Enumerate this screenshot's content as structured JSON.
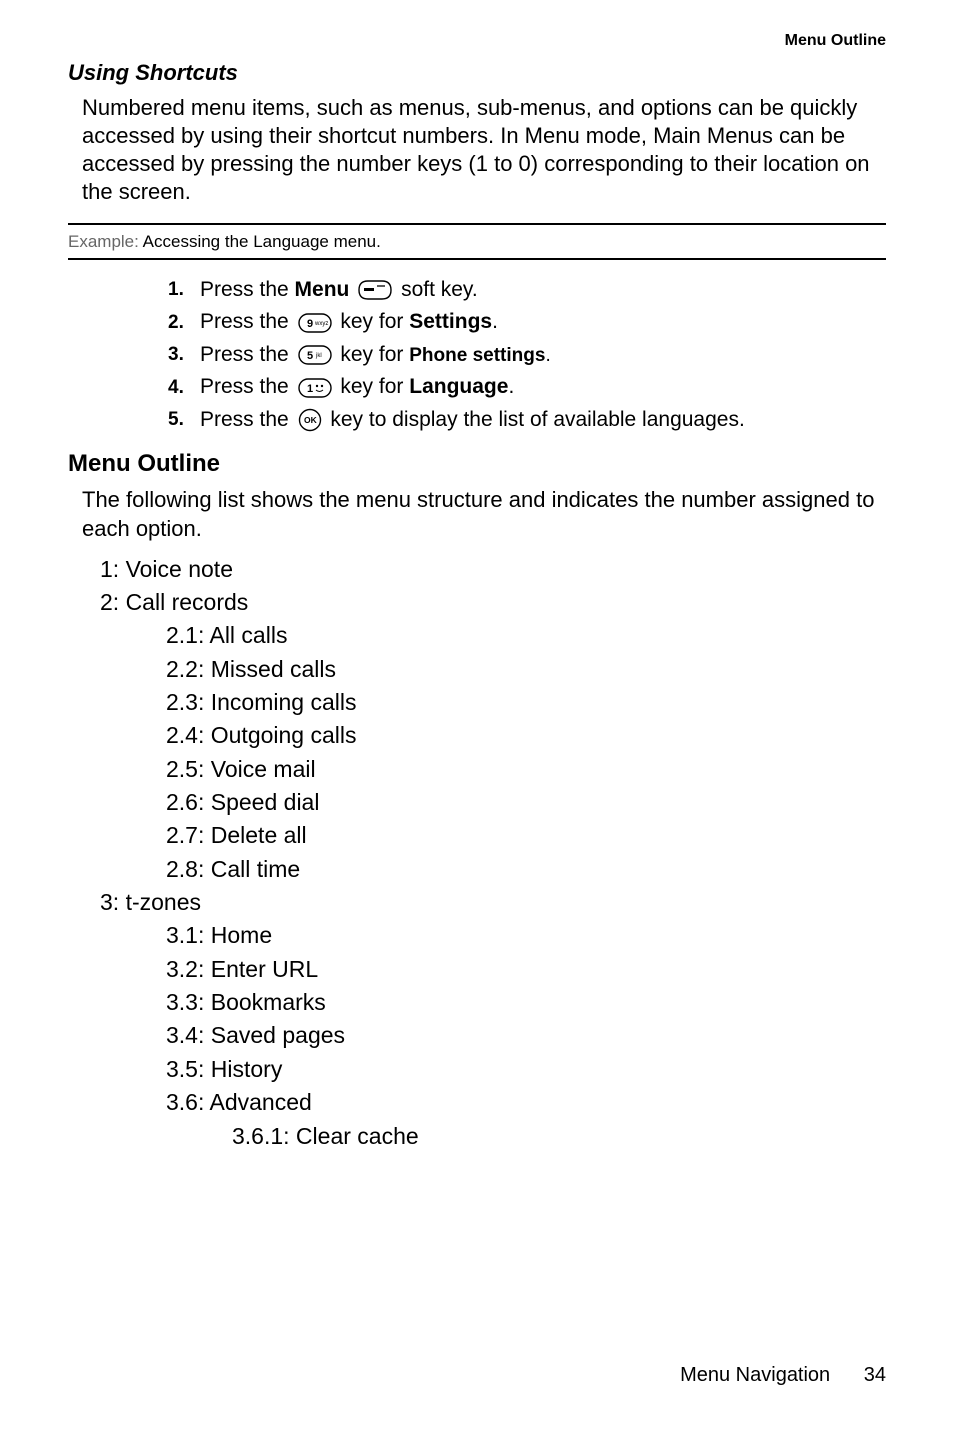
{
  "header": {
    "text": "Menu Outline"
  },
  "section1": {
    "title": "Using Shortcuts",
    "body": "Numbered menu items, such as menus, sub-menus, and options can be quickly accessed by using their shortcut numbers. In Menu mode, Main Menus can be accessed by pressing the number keys (1 to 0) corresponding to their location on the screen."
  },
  "example": {
    "label": "Example: ",
    "text": "Accessing the Language menu."
  },
  "steps": [
    {
      "num": "1.",
      "pre": "Press the ",
      "bold": "Menu",
      "icon": "softkey-left-icon",
      "post": " soft key."
    },
    {
      "num": "2.",
      "pre": "Press the ",
      "icon": "key-9-icon",
      "mid": " key for ",
      "bold": "Settings",
      "post": "."
    },
    {
      "num": "3.",
      "pre": "Press the ",
      "icon": "key-5-icon",
      "mid": " key for ",
      "bold": "Phone settings",
      "post": "."
    },
    {
      "num": "4.",
      "pre": "Press the ",
      "icon": "key-1-icon",
      "mid": " key for ",
      "bold": "Language",
      "post": "."
    },
    {
      "num": "5.",
      "pre": "Press the ",
      "icon": "ok-key-icon",
      "post": " key to display the list of available languages."
    }
  ],
  "section2": {
    "title": "Menu Outline",
    "body": "The following list shows the menu structure and indicates the number assigned to each option."
  },
  "menus": [
    {
      "level": 1,
      "text": "1: Voice note"
    },
    {
      "level": 1,
      "text": "2: Call records"
    },
    {
      "level": 2,
      "text": "2.1: All calls"
    },
    {
      "level": 2,
      "text": "2.2: Missed calls"
    },
    {
      "level": 2,
      "text": "2.3: Incoming calls"
    },
    {
      "level": 2,
      "text": "2.4: Outgoing calls"
    },
    {
      "level": 2,
      "text": "2.5: Voice mail"
    },
    {
      "level": 2,
      "text": "2.6: Speed dial"
    },
    {
      "level": 2,
      "text": "2.7: Delete all"
    },
    {
      "level": 2,
      "text": "2.8: Call time"
    },
    {
      "level": 1,
      "text": "3: t-zones"
    },
    {
      "level": 2,
      "text": "3.1: Home"
    },
    {
      "level": 2,
      "text": "3.2: Enter URL"
    },
    {
      "level": 2,
      "text": "3.3: Bookmarks"
    },
    {
      "level": 2,
      "text": "3.4: Saved pages"
    },
    {
      "level": 2,
      "text": "3.5: History"
    },
    {
      "level": 2,
      "text": "3.6: Advanced"
    },
    {
      "level": 3,
      "text": "3.6.1: Clear cache"
    }
  ],
  "footer": {
    "section": "Menu Navigation",
    "page": "34"
  },
  "icons": {
    "softkey-left-icon": "softkey",
    "key-9-icon": "9",
    "key-5-icon": "5",
    "key-1-icon": "1",
    "ok-key-icon": "OK"
  }
}
